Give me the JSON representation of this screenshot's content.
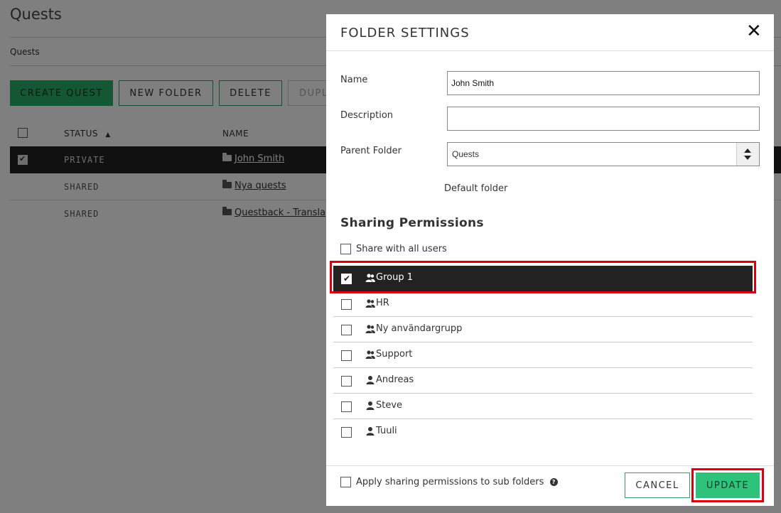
{
  "page": {
    "title": "Quests",
    "breadcrumb": "Quests"
  },
  "toolbar": {
    "create_quest": "CREATE QUEST",
    "new_folder": "NEW FOLDER",
    "delete": "DELETE",
    "duplicate": "DUPL"
  },
  "table": {
    "col_status": "STATUS",
    "sort_indicator": "▲",
    "col_name": "NAME",
    "rows": [
      {
        "status": "PRIVATE",
        "name": "John Smith",
        "selected": true
      },
      {
        "status": "SHARED",
        "name": "Nya quests",
        "selected": false
      },
      {
        "status": "SHARED",
        "name": "Questback - Transla",
        "selected": false
      }
    ]
  },
  "modal": {
    "title": "FOLDER SETTINGS",
    "close": "✕",
    "name_label": "Name",
    "name_value": "John Smith",
    "description_label": "Description",
    "description_value": "",
    "parent_label": "Parent Folder",
    "parent_value": "Quests",
    "default_folder": "Default folder",
    "sharing_title": "Sharing Permissions",
    "share_all": "Share with all users",
    "permissions": [
      {
        "name": "Group 1",
        "type": "group",
        "checked": true
      },
      {
        "name": "HR",
        "type": "group",
        "checked": false
      },
      {
        "name": "Ny användargrupp",
        "type": "group",
        "checked": false
      },
      {
        "name": "Support",
        "type": "group",
        "checked": false
      },
      {
        "name": "Andreas",
        "type": "user",
        "checked": false
      },
      {
        "name": "Steve",
        "type": "user",
        "checked": false
      },
      {
        "name": "Tuuli",
        "type": "user",
        "checked": false
      }
    ],
    "apply_sub": "Apply sharing permissions to sub folders",
    "help": "?",
    "cancel": "CANCEL",
    "update": "UPDATE"
  },
  "colors": {
    "accent_green": "#27ae68",
    "highlight_red": "#d7000f",
    "selected_row": "#222222"
  }
}
